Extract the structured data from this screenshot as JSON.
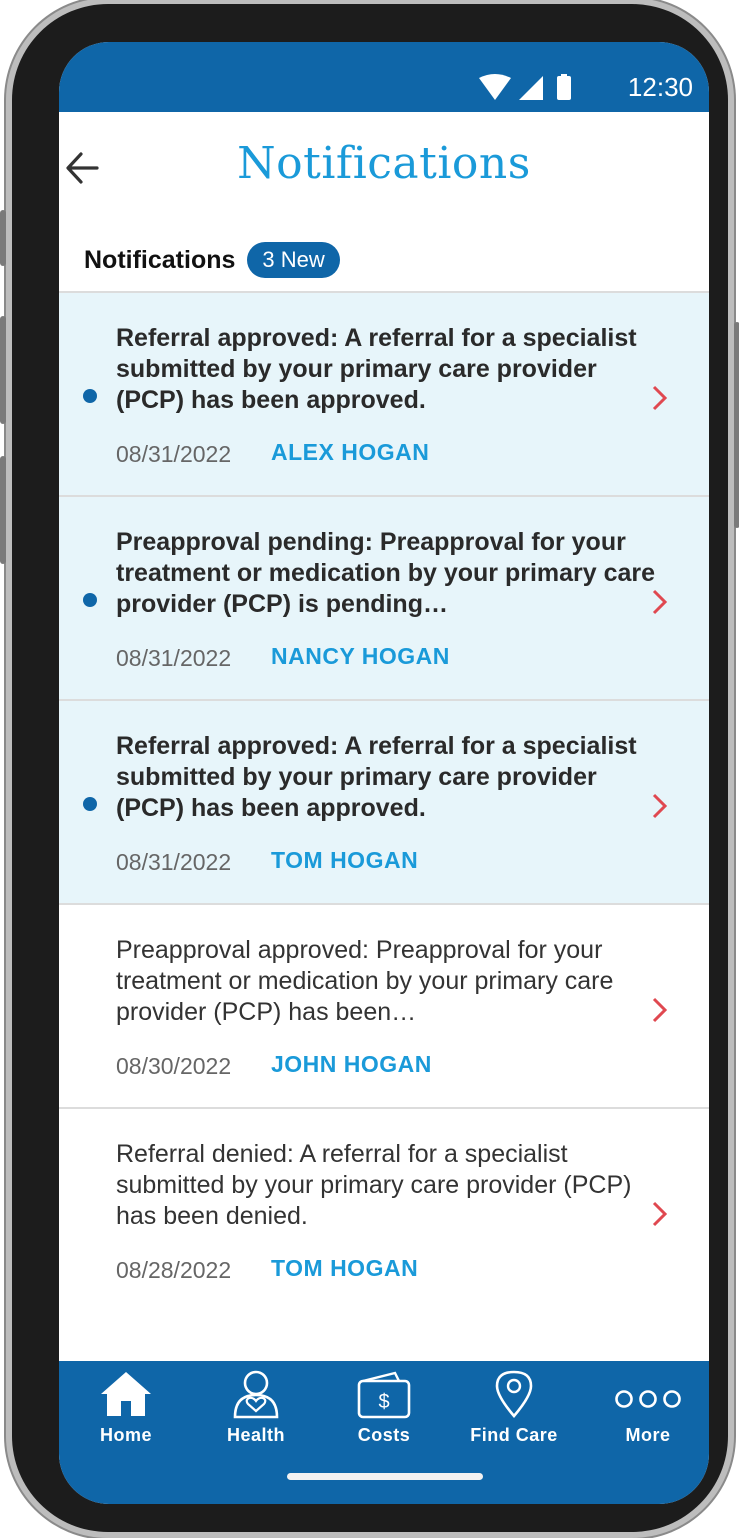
{
  "status_bar": {
    "time": "12:30"
  },
  "header": {
    "title": "Notifications"
  },
  "section": {
    "label": "Notifications",
    "badge": "3 New"
  },
  "notifications": [
    {
      "message": "Referral approved: A referral for a specialist submitted by your primary care provider (PCP) has been approved.",
      "date": "08/31/2022",
      "name": "ALEX HOGAN",
      "unread": true
    },
    {
      "message": "Preapproval pending: Preapproval for your treatment or medication by your primary care provider (PCP) is pending…",
      "date": "08/31/2022",
      "name": "NANCY HOGAN",
      "unread": true
    },
    {
      "message": "Referral approved: A referral for a specialist submitted by your primary care provider (PCP) has been approved.",
      "date": "08/31/2022",
      "name": "TOM HOGAN",
      "unread": true
    },
    {
      "message": "Preapproval approved: Preapproval for your treatment or medication by your primary care provider (PCP) has been…",
      "date": "08/30/2022",
      "name": "JOHN HOGAN",
      "unread": false
    },
    {
      "message": "Referral denied: A referral for a specialist submitted by your primary care provider (PCP) has been denied.",
      "date": "08/28/2022",
      "name": "TOM HOGAN",
      "unread": false
    }
  ],
  "nav": {
    "items": [
      {
        "label": "Home",
        "icon": "home-icon"
      },
      {
        "label": "Health",
        "icon": "health-icon"
      },
      {
        "label": "Costs",
        "icon": "costs-icon"
      },
      {
        "label": "Find Care",
        "icon": "location-pin-icon"
      },
      {
        "label": "More",
        "icon": "more-icon"
      }
    ]
  },
  "colors": {
    "primary": "#0f66a8",
    "accent": "#1a9ad9",
    "unread_bg": "#e7f5fa",
    "chevron": "#e04850"
  }
}
